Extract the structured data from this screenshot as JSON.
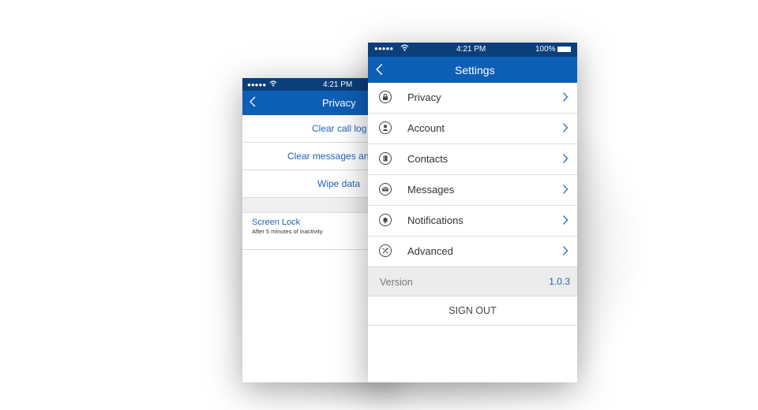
{
  "back_phone": {
    "status": {
      "signal": "●●●●●",
      "time": "4:21 PM"
    },
    "nav": {
      "title": "Privacy"
    },
    "rows": [
      {
        "label": "Clear call log"
      },
      {
        "label": "Clear messages and"
      },
      {
        "label": "Wipe data"
      }
    ],
    "screen_lock": {
      "title": "Screen Lock",
      "subtitle": "After 5 minutes of inactivity"
    }
  },
  "front_phone": {
    "status": {
      "signal": "●●●●●",
      "time": "4:21 PM",
      "battery": "100%"
    },
    "nav": {
      "title": "Settings"
    },
    "menu": [
      {
        "label": "Privacy",
        "icon": "lock-icon"
      },
      {
        "label": "Account",
        "icon": "person-icon"
      },
      {
        "label": "Contacts",
        "icon": "contacts-book-icon"
      },
      {
        "label": "Messages",
        "icon": "envelope-icon"
      },
      {
        "label": "Notifications",
        "icon": "bell-icon"
      },
      {
        "label": "Advanced",
        "icon": "tools-icon"
      }
    ],
    "version": {
      "label": "Version",
      "value": "1.0.3"
    },
    "sign_out": "SIGN OUT"
  },
  "colors": {
    "status_bar": "#0a3f7c",
    "nav_bar": "#0d5fb5",
    "link_text": "#1f63b8"
  }
}
